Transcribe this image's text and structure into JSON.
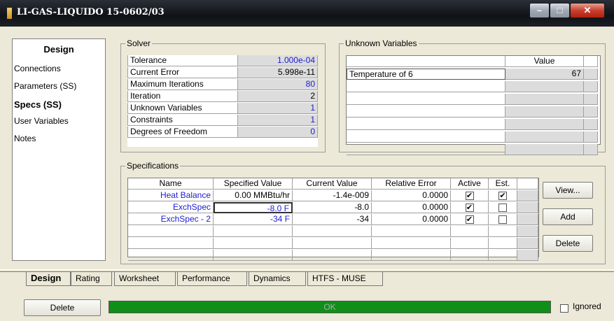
{
  "window": {
    "title": "LI-GAS-LIQUIDO 15-0602/03",
    "min_icon": "minimize-icon",
    "max_icon": "maximize-icon",
    "close_icon": "close-icon"
  },
  "nav": {
    "header": "Design",
    "items": [
      "Connections",
      "Parameters (SS)",
      "Specs (SS)",
      "User Variables",
      "Notes"
    ],
    "selected_index": 2
  },
  "solver": {
    "legend": "Solver",
    "rows": [
      {
        "label": "Tolerance",
        "value": "1.000e-04"
      },
      {
        "label": "Current Error",
        "value": "5.998e-11"
      },
      {
        "label": "Maximum Iterations",
        "value": "80"
      },
      {
        "label": "Iteration",
        "value": "2"
      },
      {
        "label": "Unknown Variables",
        "value": "1"
      },
      {
        "label": "Constraints",
        "value": "1"
      },
      {
        "label": "Degrees of Freedom",
        "value": "0"
      }
    ]
  },
  "unknowns": {
    "legend": "Unknown Variables",
    "value_header": "Value",
    "rows": [
      {
        "name": "Temperature of 6",
        "value": "67"
      }
    ]
  },
  "specs": {
    "legend": "Specifications",
    "headers": [
      "Name",
      "Specified Value",
      "Current Value",
      "Relative Error",
      "Active",
      "Est."
    ],
    "rows": [
      {
        "name": "Heat Balance",
        "specified": "0.00 MMBtu/hr",
        "current": "-1.4e-009",
        "relerr": "0.0000",
        "active": "✔",
        "est": "✔"
      },
      {
        "name": "ExchSpec",
        "specified": "-8.0 F",
        "current": "-8.0",
        "relerr": "0.0000",
        "active": "✔",
        "est": ""
      },
      {
        "name": "ExchSpec - 2",
        "specified": "-34 F",
        "current": "-34",
        "relerr": "0.0000",
        "active": "✔",
        "est": ""
      }
    ],
    "buttons": {
      "view": "View...",
      "add": "Add",
      "delete": "Delete"
    }
  },
  "tabs": [
    "Design",
    "Rating",
    "Worksheet",
    "Performance",
    "Dynamics",
    "HTFS - MUSE"
  ],
  "bottom": {
    "delete_label": "Delete",
    "status": "OK",
    "ignored_label": "Ignored"
  },
  "colors": {
    "status_ok": "#0f8f18",
    "spec_text": "#1c1cd0"
  }
}
